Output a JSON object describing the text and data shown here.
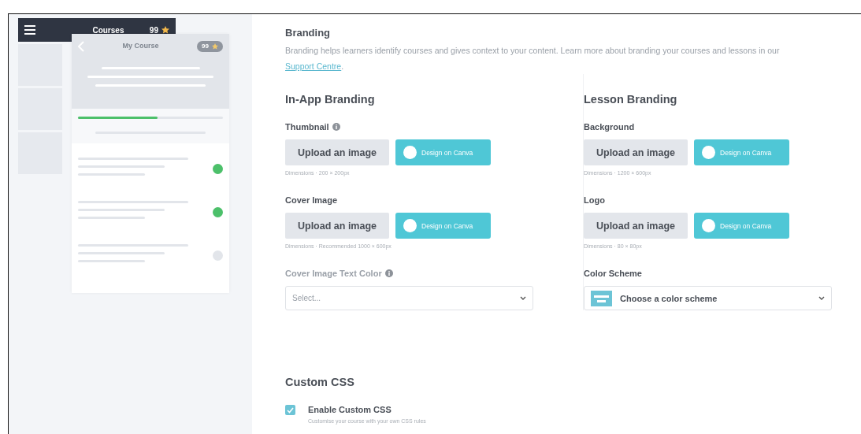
{
  "preview": {
    "header": {
      "title": "Courses",
      "badge": "99"
    },
    "course": {
      "title": "My Course",
      "badge": "99",
      "progress": {
        "level": 0.55
      }
    },
    "lessons": [
      {
        "completed": true
      },
      {
        "completed": true
      },
      {
        "completed": false
      }
    ]
  },
  "branding": {
    "title": "Branding",
    "description": "Branding helps learners identify courses and gives context to your content. Learn more about branding your courses and lessons in our ",
    "link": "Support Centre",
    "suffix": ".",
    "groups": [
      {
        "title": "In-App Branding",
        "fields": [
          {
            "kind": "upload",
            "label": "Thumbnail",
            "info": true,
            "upload": "Upload an image",
            "canva": "Design on Canva",
            "hint": "Dimensions · 200 × 200px"
          },
          {
            "kind": "upload",
            "label": "Cover Image",
            "info": false,
            "upload": "Upload an image",
            "canva": "Design on Canva",
            "hint": "Dimensions · Recommended 1000 × 600px"
          },
          {
            "kind": "select",
            "label": "Cover Image Text Color",
            "info": true,
            "disabled": true,
            "placeholder": "Select..."
          }
        ]
      },
      {
        "title": "Lesson Branding",
        "fields": [
          {
            "kind": "upload",
            "label": "Background",
            "info": false,
            "upload": "Upload an image",
            "canva": "Design on Canva",
            "hint": "Dimensions · 1200 × 600px"
          },
          {
            "kind": "upload",
            "label": "Logo",
            "info": false,
            "upload": "Upload an image",
            "canva": "Design on Canva",
            "hint": "Dimensions · 80 × 80px"
          },
          {
            "kind": "scheme",
            "label": "Color Scheme",
            "info": false,
            "disabled": false,
            "value": "Choose a color scheme"
          }
        ]
      }
    ]
  },
  "custom_css": {
    "title": "Custom CSS",
    "option": {
      "label": "Enable Custom CSS",
      "checked": true,
      "hint": "Customise your course with your own CSS rules"
    }
  }
}
